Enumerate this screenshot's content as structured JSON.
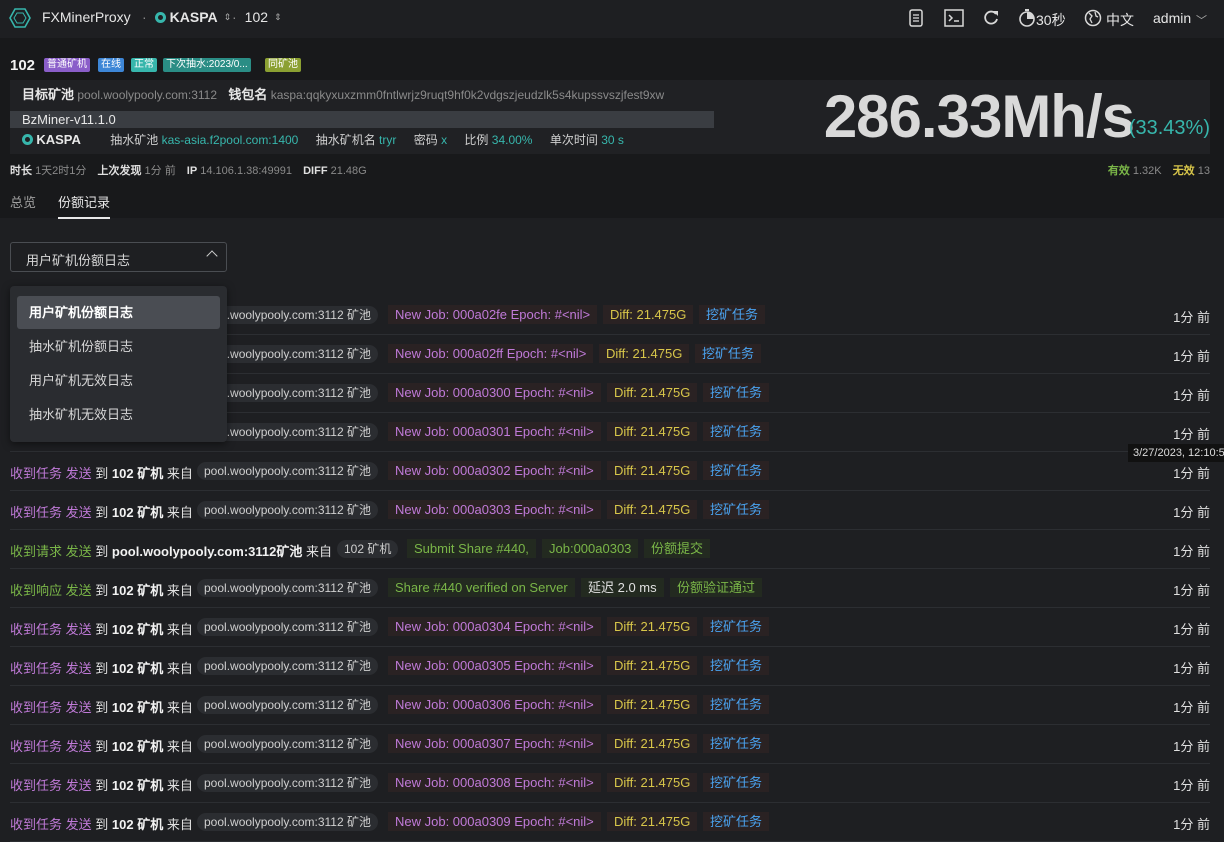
{
  "topbar": {
    "app_title": "FXMinerProxy",
    "coin": "KASPA",
    "miner": "102",
    "refresh_interval": "30秒",
    "language": "中文",
    "user": "admin"
  },
  "header": {
    "miner_id": "102",
    "badges": [
      "普通矿机",
      "在线",
      "正常",
      "下次抽水:2023/0...",
      "同矿池"
    ],
    "target_pool_label": "目标矿池",
    "target_pool_value": "pool.woolypooly.com:3112",
    "wallet_label": "钱包名",
    "wallet_value": "kaspa:qqkyxuxzmm0fntlwrjz9ruqt9hf0k2vdgszjeudzlk5s4kupssvszjfest9xw",
    "software": "BzMiner-v11.1.0",
    "coin": "KASPA",
    "fee_pool_label": "抽水矿池",
    "fee_pool_value": "kas-asia.f2pool.com:1400",
    "fee_miner_label": "抽水矿机名",
    "fee_miner_value": "tryr",
    "password_label": "密码",
    "password_value": "x",
    "ratio_label": "比例",
    "ratio_value": "34.00%",
    "single_time_label": "单次时间",
    "single_time_value": "30 s",
    "hashrate": "286.33Mh/s",
    "hashrate_pct": "(33.43%)",
    "uptime_label": "时长",
    "uptime_value": "1天2时1分",
    "last_seen_label": "上次发现",
    "last_seen_value": "1分 前",
    "ip_label": "IP",
    "ip_value": "14.106.1.38:49991",
    "diff_label": "DIFF",
    "diff_value": "21.48G",
    "valid_label": "有效",
    "valid_value": "1.32K",
    "invalid_label": "无效",
    "invalid_value": "13"
  },
  "tabs": [
    "总览",
    "份额记录"
  ],
  "log_select": {
    "value": "用户矿机份额日志",
    "options": [
      "用户矿机份额日志",
      "抽水矿机份额日志",
      "用户矿机无效日志",
      "抽水矿机无效日志"
    ]
  },
  "tooltip": "3/27/2023, 12:10:5",
  "rows": [
    {
      "kind": "job",
      "pill": "pool.woolypooly.com:3112 矿池",
      "c1": "New Job: 000a02fe Epoch: #<nil>",
      "c2": "Diff: 21.475G",
      "c3": "挖矿任务",
      "time": "1分 前"
    },
    {
      "kind": "job",
      "pill": "pool.woolypooly.com:3112 矿池",
      "c1": "New Job: 000a02ff Epoch: #<nil>",
      "c2": "Diff: 21.475G",
      "c3": "挖矿任务",
      "time": "1分 前"
    },
    {
      "kind": "job",
      "pill": "pool.woolypooly.com:3112 矿池",
      "c1": "New Job: 000a0300 Epoch: #<nil>",
      "c2": "Diff: 21.475G",
      "c3": "挖矿任务",
      "time": "1分 前"
    },
    {
      "kind": "job",
      "pill": "pool.woolypooly.com:3112 矿池",
      "c1": "New Job: 000a0301 Epoch: #<nil>",
      "c2": "Diff: 21.475G",
      "c3": "挖矿任务",
      "time": "1分 前"
    },
    {
      "kind": "job",
      "a": "收到任务",
      "b": "发送",
      "c": "到",
      "d": "102 矿机",
      "e": "来自",
      "pill": "pool.woolypooly.com:3112 矿池",
      "c1": "New Job: 000a0302 Epoch: #<nil>",
      "c2": "Diff: 21.475G",
      "c3": "挖矿任务",
      "time": "1分 前"
    },
    {
      "kind": "job",
      "a": "收到任务",
      "b": "发送",
      "c": "到",
      "d": "102 矿机",
      "e": "来自",
      "pill": "pool.woolypooly.com:3112 矿池",
      "c1": "New Job: 000a0303 Epoch: #<nil>",
      "c2": "Diff: 21.475G",
      "c3": "挖矿任务",
      "time": "1分 前"
    },
    {
      "kind": "req",
      "a": "收到请求",
      "b": "发送",
      "c": "到",
      "d": "pool.woolypooly.com:3112矿池",
      "e": "来自",
      "pill": "102 矿机",
      "c1": "Submit Share #440,",
      "c2": "Job:000a0303",
      "c3": "份额提交",
      "time": "1分 前"
    },
    {
      "kind": "resp",
      "a": "收到响应",
      "b": "发送",
      "c": "到",
      "d": "102 矿机",
      "e": "来自",
      "pill": "pool.woolypooly.com:3112 矿池",
      "c1": "Share #440 verified on Server",
      "c2": "延迟 2.0 ms",
      "c3": "份额验证通过",
      "time": "1分 前"
    },
    {
      "kind": "job",
      "a": "收到任务",
      "b": "发送",
      "c": "到",
      "d": "102 矿机",
      "e": "来自",
      "pill": "pool.woolypooly.com:3112 矿池",
      "c1": "New Job: 000a0304 Epoch: #<nil>",
      "c2": "Diff: 21.475G",
      "c3": "挖矿任务",
      "time": "1分 前"
    },
    {
      "kind": "job",
      "a": "收到任务",
      "b": "发送",
      "c": "到",
      "d": "102 矿机",
      "e": "来自",
      "pill": "pool.woolypooly.com:3112 矿池",
      "c1": "New Job: 000a0305 Epoch: #<nil>",
      "c2": "Diff: 21.475G",
      "c3": "挖矿任务",
      "time": "1分 前"
    },
    {
      "kind": "job",
      "a": "收到任务",
      "b": "发送",
      "c": "到",
      "d": "102 矿机",
      "e": "来自",
      "pill": "pool.woolypooly.com:3112 矿池",
      "c1": "New Job: 000a0306 Epoch: #<nil>",
      "c2": "Diff: 21.475G",
      "c3": "挖矿任务",
      "time": "1分 前"
    },
    {
      "kind": "job",
      "a": "收到任务",
      "b": "发送",
      "c": "到",
      "d": "102 矿机",
      "e": "来自",
      "pill": "pool.woolypooly.com:3112 矿池",
      "c1": "New Job: 000a0307 Epoch: #<nil>",
      "c2": "Diff: 21.475G",
      "c3": "挖矿任务",
      "time": "1分 前"
    },
    {
      "kind": "job",
      "a": "收到任务",
      "b": "发送",
      "c": "到",
      "d": "102 矿机",
      "e": "来自",
      "pill": "pool.woolypooly.com:3112 矿池",
      "c1": "New Job: 000a0308 Epoch: #<nil>",
      "c2": "Diff: 21.475G",
      "c3": "挖矿任务",
      "time": "1分 前"
    },
    {
      "kind": "job",
      "a": "收到任务",
      "b": "发送",
      "c": "到",
      "d": "102 矿机",
      "e": "来自",
      "pill": "pool.woolypooly.com:3112 矿池",
      "c1": "New Job: 000a0309 Epoch: #<nil>",
      "c2": "Diff: 21.475G",
      "c3": "挖矿任务",
      "time": "1分 前"
    }
  ],
  "colors": {
    "accent": "#37b6ac",
    "job_purple": "#c07ad8",
    "req_green": "#7ab648",
    "diff_yellow": "#d8c64a",
    "task_blue": "#4aa3f0"
  }
}
